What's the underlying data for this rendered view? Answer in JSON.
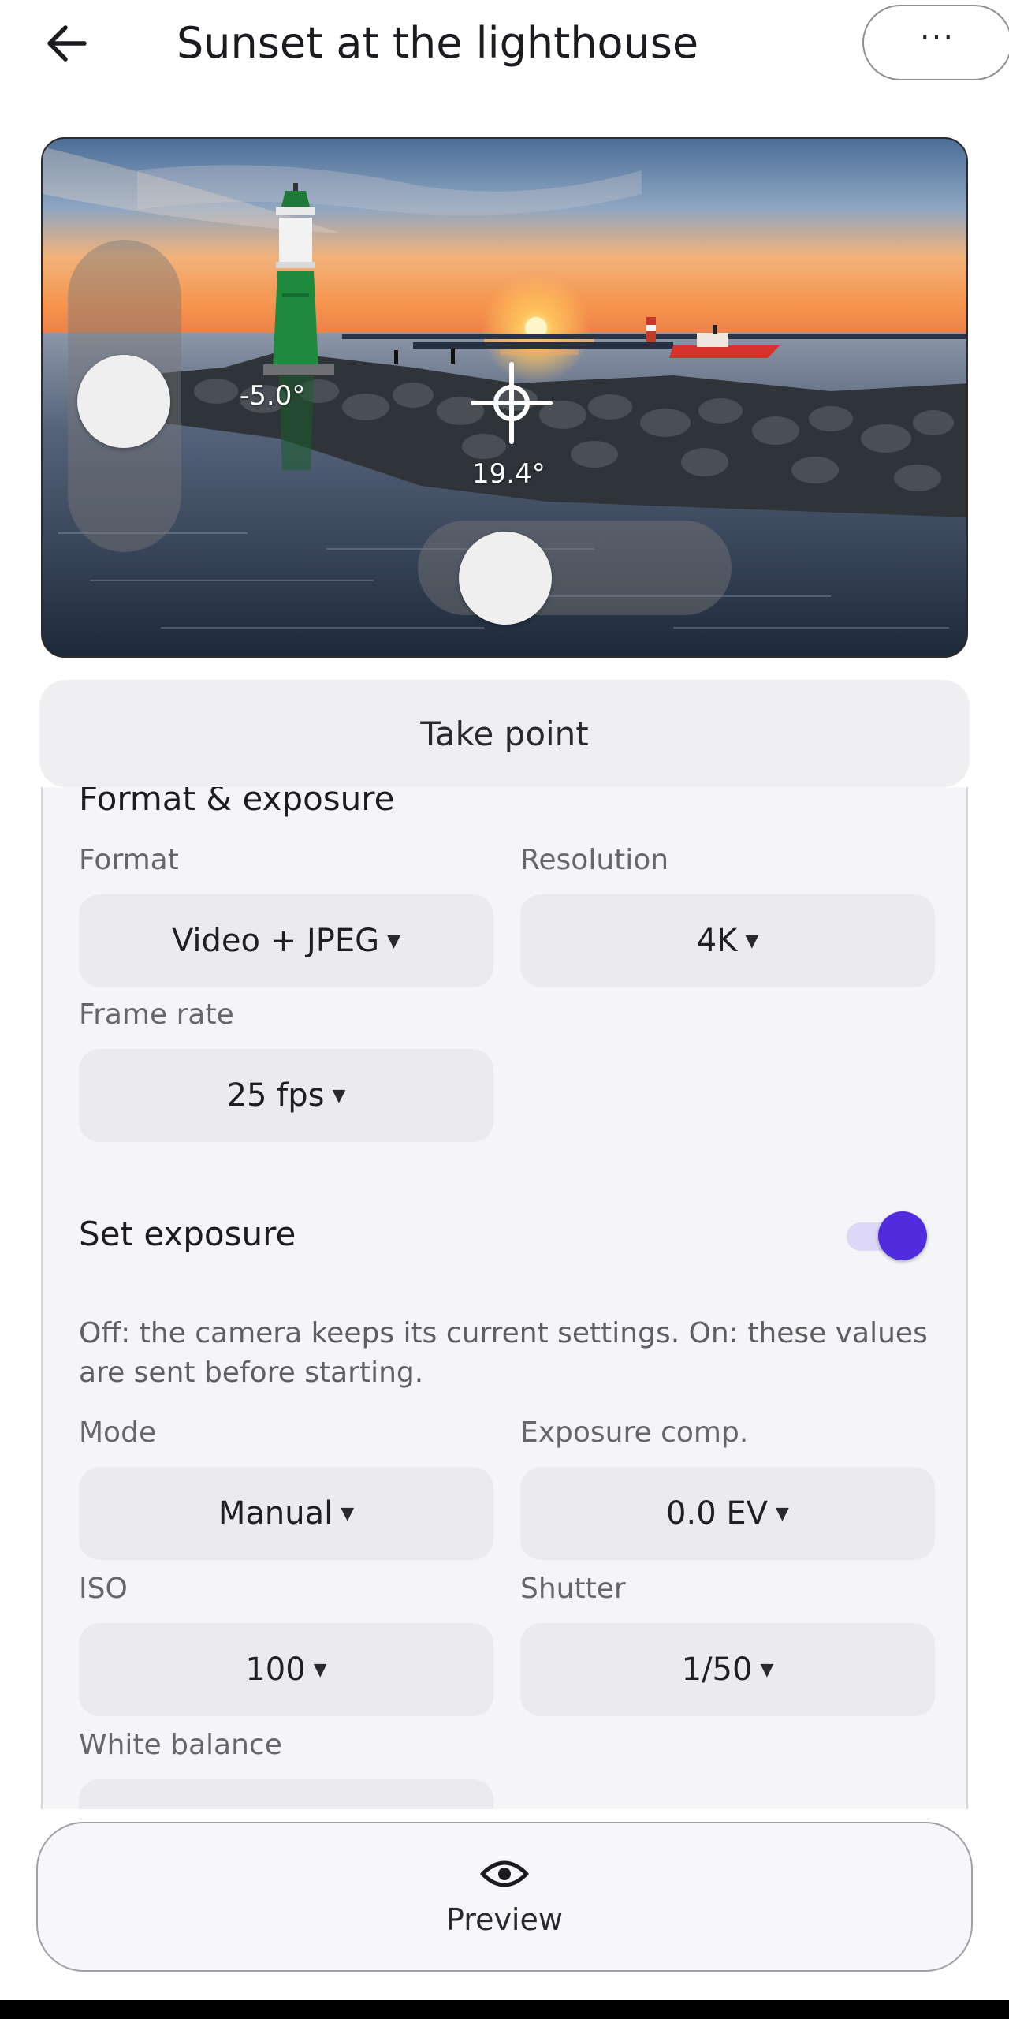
{
  "header": {
    "title": "Sunset at the lighthouse",
    "back_icon": "arrow-left-icon",
    "more_label": "···"
  },
  "viewport": {
    "tilt_readout": "-5.0°",
    "pan_readout": "19.4°",
    "crosshair_icon": "crosshair-icon"
  },
  "actions": {
    "take_point": "Take point"
  },
  "format_section": {
    "title": "Format & exposure",
    "format_label": "Format",
    "format_value": "Video + JPEG",
    "resolution_label": "Resolution",
    "resolution_value": "4K",
    "framerate_label": "Frame rate",
    "framerate_value": "25 fps"
  },
  "exposure_section": {
    "title": "Set exposure",
    "enabled": true,
    "description": "Off: the camera keeps its current settings. On: these values are sent before starting.",
    "mode_label": "Mode",
    "mode_value": "Manual",
    "comp_label": "Exposure comp.",
    "comp_value": "0.0 EV",
    "iso_label": "ISO",
    "iso_value": "100",
    "shutter_label": "Shutter",
    "shutter_value": "1/50",
    "wb_label": "White balance"
  },
  "footer": {
    "preview_label": "Preview",
    "preview_icon": "eye-icon"
  },
  "colors": {
    "accent": "#4f2cdd",
    "accent_track": "#dcd6f7",
    "field_bg": "#ebebef",
    "panel_bg": "#f5f5f8"
  }
}
